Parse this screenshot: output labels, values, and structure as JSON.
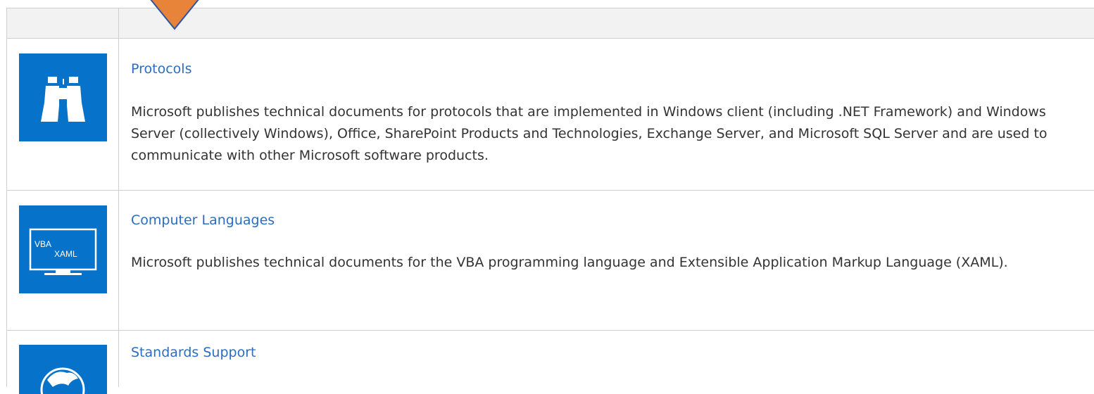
{
  "rows": [
    {
      "title": "Protocols",
      "icon": "binoculars-icon",
      "description": "Microsoft publishes technical documents for protocols that are implemented in Windows client (including .NET Framework) and Windows Server (collectively Windows), Office, SharePoint Products and Technologies, Exchange Server, and Microsoft SQL Server and are used to communicate with other Microsoft software products."
    },
    {
      "title": "Computer Languages",
      "icon": "monitor-icon",
      "icon_text_1": "VBA",
      "icon_text_2": "XAML",
      "description": "Microsoft publishes technical documents for the VBA programming language and Extensible Application Markup Language (XAML)."
    },
    {
      "title": "Standards Support",
      "icon": "globe-icon",
      "description": ""
    }
  ],
  "colors": {
    "tile": "#0672c9",
    "link": "#2a6dc2",
    "text": "#333333",
    "header_bg": "#f2f2f2",
    "border": "#cfcfcf",
    "marker_fill": "#e8833a",
    "marker_stroke": "#2f55a4"
  },
  "marker": "down-arrow-icon"
}
